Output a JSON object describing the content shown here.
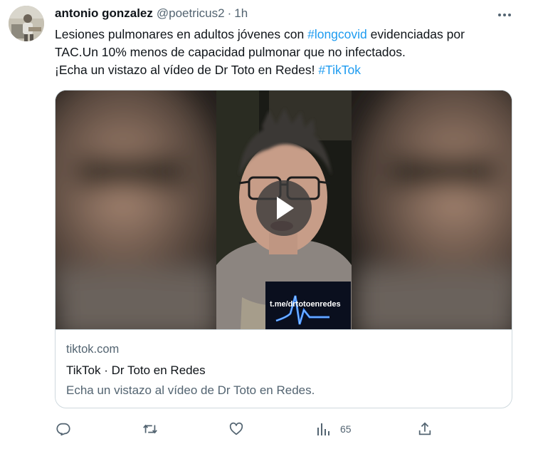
{
  "colors": {
    "accent": "#1d9bf0",
    "text_primary": "#0f1419",
    "text_secondary": "#536471",
    "border": "#cfd9de"
  },
  "tweet": {
    "author_name": "antonio gonzalez",
    "author_handle": "@poetricus2",
    "separator": "·",
    "time": "1h",
    "avatar_icon": "avatar-icon",
    "more_icon": "more-options-icon",
    "text": {
      "line1_before": "Lesiones pulmonares en adultos jóvenes con ",
      "hashtag_longcovid": "#longcovid",
      "line1_after": " evidenciadas por",
      "line2": "TAC.Un 10% menos de capacidad pulmonar que no infectados.",
      "line3_before": "¡Echa un vistazo al vídeo de Dr Toto en Redes! ",
      "hashtag_tiktok": "#TikTok"
    }
  },
  "card": {
    "play_icon": "play-icon",
    "watermark_text": "t.me/drtotoenredes",
    "domain": "tiktok.com",
    "title": "TikTok · Dr Toto en Redes",
    "description": "Echa un vistazo al vídeo de Dr Toto en Redes."
  },
  "actions": {
    "reply_icon": "reply-icon",
    "retweet_icon": "retweet-icon",
    "like_icon": "like-icon",
    "views_icon": "views-icon",
    "views_count": "65",
    "share_icon": "share-icon"
  }
}
